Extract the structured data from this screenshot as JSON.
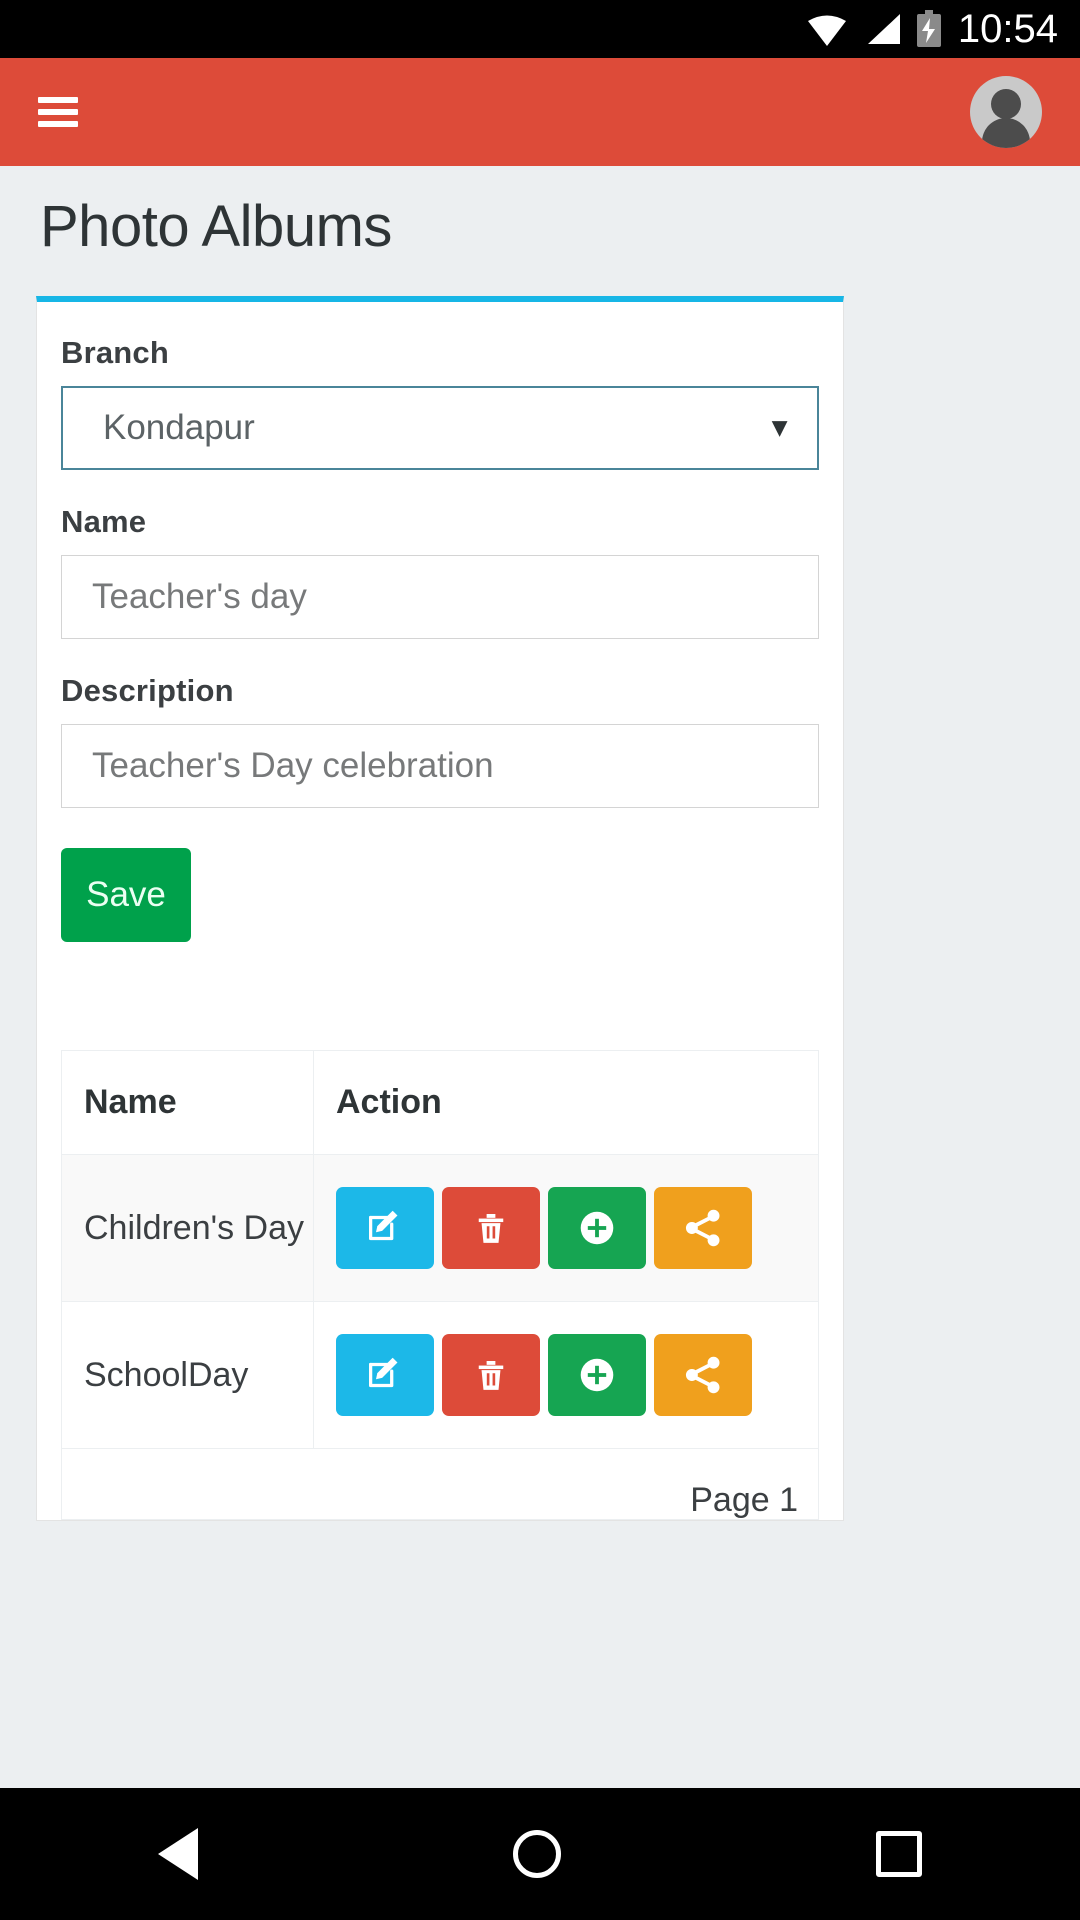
{
  "status_bar": {
    "time": "10:54",
    "icons": [
      "wifi-icon",
      "signal-icon",
      "battery-charging-icon"
    ]
  },
  "app_bar": {
    "menu_icon": "hamburger-menu-icon",
    "avatar_icon": "user-avatar-icon",
    "background_color": "#dd4b39"
  },
  "page": {
    "title": "Photo Albums",
    "accent_color": "#17b6e6",
    "background_color": "#eceff1"
  },
  "form": {
    "branch": {
      "label": "Branch",
      "value": "Kondapur",
      "caret": "▼",
      "border_color": "#4a8599"
    },
    "name": {
      "label": "Name",
      "value": "Teacher's day",
      "placeholder": "Teacher's day"
    },
    "description": {
      "label": "Description",
      "value": "Teacher's Day celebration",
      "placeholder": "Teacher's Day celebration"
    },
    "save_label": "Save",
    "save_color": "#00a14b"
  },
  "table": {
    "columns": [
      "Name",
      "Action"
    ],
    "rows": [
      {
        "name": "Children's Day"
      },
      {
        "name": "SchoolDay"
      }
    ],
    "actions": [
      {
        "name": "edit-button",
        "icon": "pencil-square-icon",
        "color": "#1cb8e8"
      },
      {
        "name": "delete-button",
        "icon": "trash-icon",
        "color": "#dd4b39"
      },
      {
        "name": "add-button",
        "icon": "plus-circle-icon",
        "color": "#16a552"
      },
      {
        "name": "share-button",
        "icon": "share-icon",
        "color": "#f0a01d"
      }
    ],
    "footer_label": "Page 1"
  },
  "nav_bar": {
    "back": "back-triangle-icon",
    "home": "home-circle-icon",
    "recents": "recents-square-icon"
  }
}
